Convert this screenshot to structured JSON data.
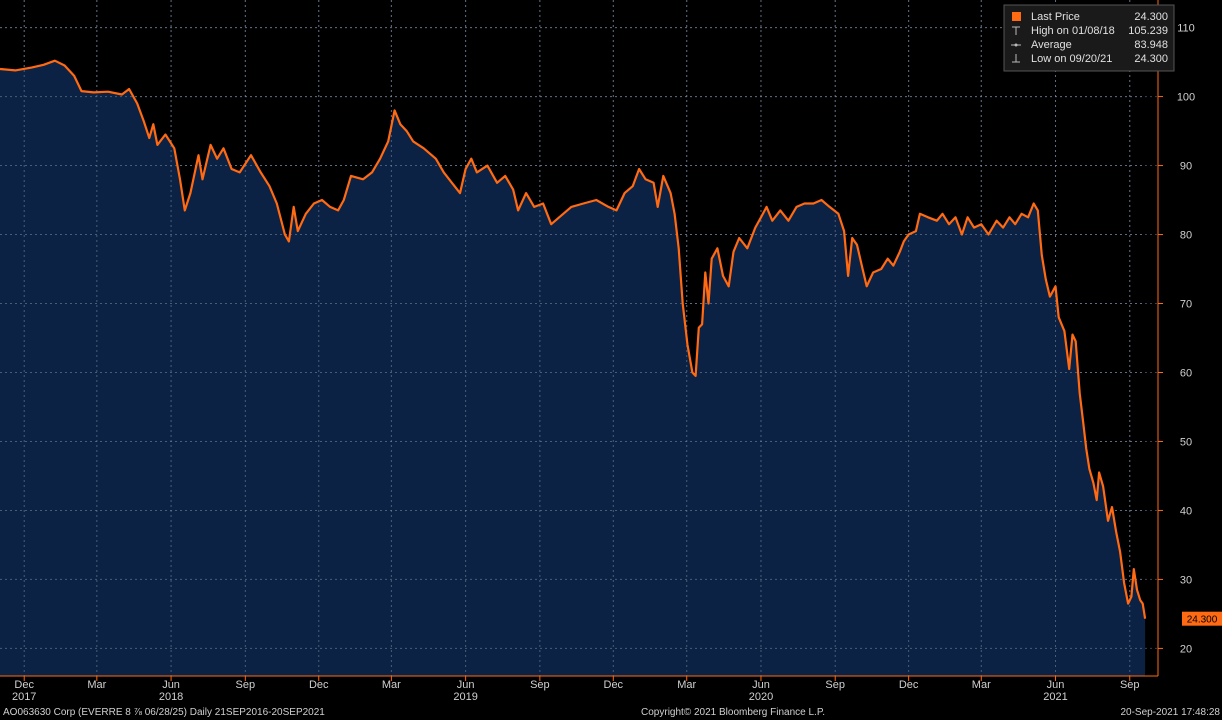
{
  "chart_data": {
    "type": "area",
    "ylim": [
      16,
      114
    ],
    "y_ticks": [
      20,
      30,
      40,
      50,
      60,
      70,
      80,
      90,
      100,
      110
    ],
    "grid": true,
    "legend_position": "top-right",
    "x_ticks": [
      {
        "label": "Dec",
        "date": "2017-12-01"
      },
      {
        "label": "Mar",
        "date": "2018-03-01"
      },
      {
        "label": "Jun",
        "date": "2018-06-01"
      },
      {
        "label": "Sep",
        "date": "2018-09-01"
      },
      {
        "label": "Dec",
        "date": "2018-12-01"
      },
      {
        "label": "Mar",
        "date": "2019-03-01"
      },
      {
        "label": "Jun",
        "date": "2019-06-01"
      },
      {
        "label": "Sep",
        "date": "2019-09-01"
      },
      {
        "label": "Dec",
        "date": "2019-12-01"
      },
      {
        "label": "Mar",
        "date": "2020-03-01"
      },
      {
        "label": "Jun",
        "date": "2020-06-01"
      },
      {
        "label": "Sep",
        "date": "2020-09-01"
      },
      {
        "label": "Dec",
        "date": "2020-12-01"
      },
      {
        "label": "Mar",
        "date": "2021-03-01"
      },
      {
        "label": "Jun",
        "date": "2021-06-01"
      },
      {
        "label": "Sep",
        "date": "2021-09-01"
      }
    ],
    "year_labels": [
      {
        "label": "2017",
        "date": "2017-12-01"
      },
      {
        "label": "2018",
        "date": "2018-06-01"
      },
      {
        "label": "2019",
        "date": "2019-06-01"
      },
      {
        "label": "2020",
        "date": "2020-06-01"
      },
      {
        "label": "2021",
        "date": "2021-06-01"
      }
    ],
    "x_range": [
      "2017-11-01",
      "2021-10-06"
    ],
    "series": [
      {
        "name": "Last Price",
        "color": "#ff6a13",
        "fill": "#0b2244",
        "points": [
          [
            "2017-11-01",
            104.0
          ],
          [
            "2017-11-20",
            103.8
          ],
          [
            "2017-12-10",
            104.2
          ],
          [
            "2017-12-25",
            104.6
          ],
          [
            "2018-01-08",
            105.2
          ],
          [
            "2018-01-20",
            104.5
          ],
          [
            "2018-02-01",
            103.0
          ],
          [
            "2018-02-10",
            100.8
          ],
          [
            "2018-02-25",
            100.6
          ],
          [
            "2018-03-15",
            100.7
          ],
          [
            "2018-04-01",
            100.3
          ],
          [
            "2018-04-10",
            101.1
          ],
          [
            "2018-04-20",
            99.0
          ],
          [
            "2018-04-28",
            96.5
          ],
          [
            "2018-05-05",
            94.0
          ],
          [
            "2018-05-10",
            96.0
          ],
          [
            "2018-05-15",
            93.0
          ],
          [
            "2018-05-25",
            94.5
          ],
          [
            "2018-06-05",
            92.5
          ],
          [
            "2018-06-12",
            88.0
          ],
          [
            "2018-06-18",
            83.5
          ],
          [
            "2018-06-25",
            86.0
          ],
          [
            "2018-07-05",
            91.5
          ],
          [
            "2018-07-10",
            88.0
          ],
          [
            "2018-07-20",
            93.0
          ],
          [
            "2018-07-28",
            91.0
          ],
          [
            "2018-08-05",
            92.5
          ],
          [
            "2018-08-15",
            89.5
          ],
          [
            "2018-08-25",
            89.0
          ],
          [
            "2018-09-08",
            91.5
          ],
          [
            "2018-09-20",
            89.0
          ],
          [
            "2018-10-01",
            87.0
          ],
          [
            "2018-10-10",
            84.5
          ],
          [
            "2018-10-20",
            80.0
          ],
          [
            "2018-10-25",
            79.0
          ],
          [
            "2018-10-31",
            84.0
          ],
          [
            "2018-11-05",
            80.5
          ],
          [
            "2018-11-15",
            83.0
          ],
          [
            "2018-11-25",
            84.5
          ],
          [
            "2018-12-05",
            85.0
          ],
          [
            "2018-12-15",
            84.0
          ],
          [
            "2018-12-25",
            83.5
          ],
          [
            "2019-01-01",
            85.0
          ],
          [
            "2019-01-10",
            88.5
          ],
          [
            "2019-01-25",
            88.0
          ],
          [
            "2019-02-05",
            89.0
          ],
          [
            "2019-02-15",
            91.0
          ],
          [
            "2019-02-25",
            93.5
          ],
          [
            "2019-03-05",
            98.0
          ],
          [
            "2019-03-12",
            96.0
          ],
          [
            "2019-03-20",
            95.0
          ],
          [
            "2019-03-28",
            93.5
          ],
          [
            "2019-04-10",
            92.5
          ],
          [
            "2019-04-25",
            91.0
          ],
          [
            "2019-05-05",
            89.0
          ],
          [
            "2019-05-15",
            87.5
          ],
          [
            "2019-05-25",
            86.0
          ],
          [
            "2019-06-01",
            89.5
          ],
          [
            "2019-06-08",
            91.0
          ],
          [
            "2019-06-15",
            89.0
          ],
          [
            "2019-06-28",
            90.0
          ],
          [
            "2019-07-10",
            87.5
          ],
          [
            "2019-07-20",
            88.5
          ],
          [
            "2019-07-30",
            86.5
          ],
          [
            "2019-08-05",
            83.5
          ],
          [
            "2019-08-15",
            86.0
          ],
          [
            "2019-08-25",
            84.0
          ],
          [
            "2019-09-05",
            84.5
          ],
          [
            "2019-09-15",
            81.5
          ],
          [
            "2019-09-25",
            82.5
          ],
          [
            "2019-10-10",
            84.0
          ],
          [
            "2019-10-25",
            84.5
          ],
          [
            "2019-11-10",
            85.0
          ],
          [
            "2019-11-25",
            84.0
          ],
          [
            "2019-12-05",
            83.5
          ],
          [
            "2019-12-15",
            86.0
          ],
          [
            "2019-12-25",
            87.0
          ],
          [
            "2020-01-02",
            89.5
          ],
          [
            "2020-01-10",
            88.0
          ],
          [
            "2020-01-20",
            87.5
          ],
          [
            "2020-01-25",
            84.0
          ],
          [
            "2020-02-01",
            88.5
          ],
          [
            "2020-02-10",
            86.0
          ],
          [
            "2020-02-15",
            83.0
          ],
          [
            "2020-02-20",
            78.0
          ],
          [
            "2020-02-25",
            70.0
          ],
          [
            "2020-03-02",
            64.0
          ],
          [
            "2020-03-08",
            60.0
          ],
          [
            "2020-03-12",
            59.5
          ],
          [
            "2020-03-16",
            66.5
          ],
          [
            "2020-03-20",
            67.0
          ],
          [
            "2020-03-24",
            74.5
          ],
          [
            "2020-03-28",
            70.0
          ],
          [
            "2020-04-01",
            76.5
          ],
          [
            "2020-04-08",
            78.0
          ],
          [
            "2020-04-15",
            74.0
          ],
          [
            "2020-04-22",
            72.5
          ],
          [
            "2020-04-28",
            77.5
          ],
          [
            "2020-05-05",
            79.5
          ],
          [
            "2020-05-15",
            78.0
          ],
          [
            "2020-05-25",
            81.0
          ],
          [
            "2020-06-01",
            82.5
          ],
          [
            "2020-06-08",
            84.0
          ],
          [
            "2020-06-15",
            82.0
          ],
          [
            "2020-06-25",
            83.5
          ],
          [
            "2020-07-05",
            82.0
          ],
          [
            "2020-07-15",
            84.0
          ],
          [
            "2020-07-25",
            84.5
          ],
          [
            "2020-08-05",
            84.5
          ],
          [
            "2020-08-15",
            85.0
          ],
          [
            "2020-08-25",
            84.0
          ],
          [
            "2020-09-05",
            83.0
          ],
          [
            "2020-09-12",
            80.5
          ],
          [
            "2020-09-17",
            74.0
          ],
          [
            "2020-09-22",
            79.5
          ],
          [
            "2020-09-28",
            78.5
          ],
          [
            "2020-10-05",
            75.0
          ],
          [
            "2020-10-10",
            72.5
          ],
          [
            "2020-10-18",
            74.5
          ],
          [
            "2020-10-28",
            75.0
          ],
          [
            "2020-11-05",
            76.5
          ],
          [
            "2020-11-12",
            75.5
          ],
          [
            "2020-11-20",
            77.5
          ],
          [
            "2020-11-25",
            79.0
          ],
          [
            "2020-12-01",
            80.0
          ],
          [
            "2020-12-10",
            80.5
          ],
          [
            "2020-12-15",
            83.0
          ],
          [
            "2020-12-25",
            82.5
          ],
          [
            "2021-01-05",
            82.0
          ],
          [
            "2021-01-12",
            83.0
          ],
          [
            "2021-01-20",
            81.5
          ],
          [
            "2021-01-28",
            82.5
          ],
          [
            "2021-02-05",
            80.0
          ],
          [
            "2021-02-12",
            82.5
          ],
          [
            "2021-02-20",
            81.0
          ],
          [
            "2021-03-01",
            81.5
          ],
          [
            "2021-03-10",
            80.0
          ],
          [
            "2021-03-20",
            82.0
          ],
          [
            "2021-03-28",
            81.0
          ],
          [
            "2021-04-05",
            82.5
          ],
          [
            "2021-04-12",
            81.5
          ],
          [
            "2021-04-20",
            83.0
          ],
          [
            "2021-04-28",
            82.5
          ],
          [
            "2021-05-05",
            84.5
          ],
          [
            "2021-05-10",
            83.5
          ],
          [
            "2021-05-15",
            77.0
          ],
          [
            "2021-05-20",
            73.5
          ],
          [
            "2021-05-25",
            71.0
          ],
          [
            "2021-06-01",
            72.5
          ],
          [
            "2021-06-05",
            68.0
          ],
          [
            "2021-06-12",
            66.0
          ],
          [
            "2021-06-18",
            60.5
          ],
          [
            "2021-06-22",
            65.5
          ],
          [
            "2021-06-26",
            64.5
          ],
          [
            "2021-07-01",
            57.0
          ],
          [
            "2021-07-05",
            53.0
          ],
          [
            "2021-07-09",
            49.0
          ],
          [
            "2021-07-13",
            46.0
          ],
          [
            "2021-07-18",
            44.0
          ],
          [
            "2021-07-22",
            41.5
          ],
          [
            "2021-07-25",
            45.5
          ],
          [
            "2021-07-30",
            43.5
          ],
          [
            "2021-08-05",
            38.5
          ],
          [
            "2021-08-10",
            40.5
          ],
          [
            "2021-08-15",
            37.0
          ],
          [
            "2021-08-20",
            34.0
          ],
          [
            "2021-08-25",
            29.5
          ],
          [
            "2021-08-30",
            26.5
          ],
          [
            "2021-09-03",
            27.5
          ],
          [
            "2021-09-06",
            31.5
          ],
          [
            "2021-09-10",
            28.5
          ],
          [
            "2021-09-14",
            27.0
          ],
          [
            "2021-09-17",
            26.5
          ],
          [
            "2021-09-20",
            24.3
          ]
        ]
      }
    ],
    "legend": {
      "rows": [
        {
          "icon": "filled-square-icon",
          "label": "Last Price",
          "value": "24.300"
        },
        {
          "icon": "high-marker-icon",
          "label": "High on 01/08/18",
          "value": "105.239"
        },
        {
          "icon": "average-marker-icon",
          "label": "Average",
          "value": "83.948"
        },
        {
          "icon": "low-marker-icon",
          "label": "Low on 09/20/21",
          "value": "24.300"
        }
      ]
    },
    "last_value_label": "24.300"
  },
  "footer": {
    "left": "AO063630 Corp (EVERRE 8 ⅞ 06/28/25)  Daily 21SEP2016-20SEP2021",
    "center": "Copyright© 2021 Bloomberg Finance L.P.",
    "right": "20-Sep-2021 17:48:28"
  },
  "colors": {
    "background": "#000000",
    "plot_fill": "#0b2244",
    "line": "#ff6a13",
    "grid": "#6a7a90",
    "axis": "#ff6a13"
  }
}
